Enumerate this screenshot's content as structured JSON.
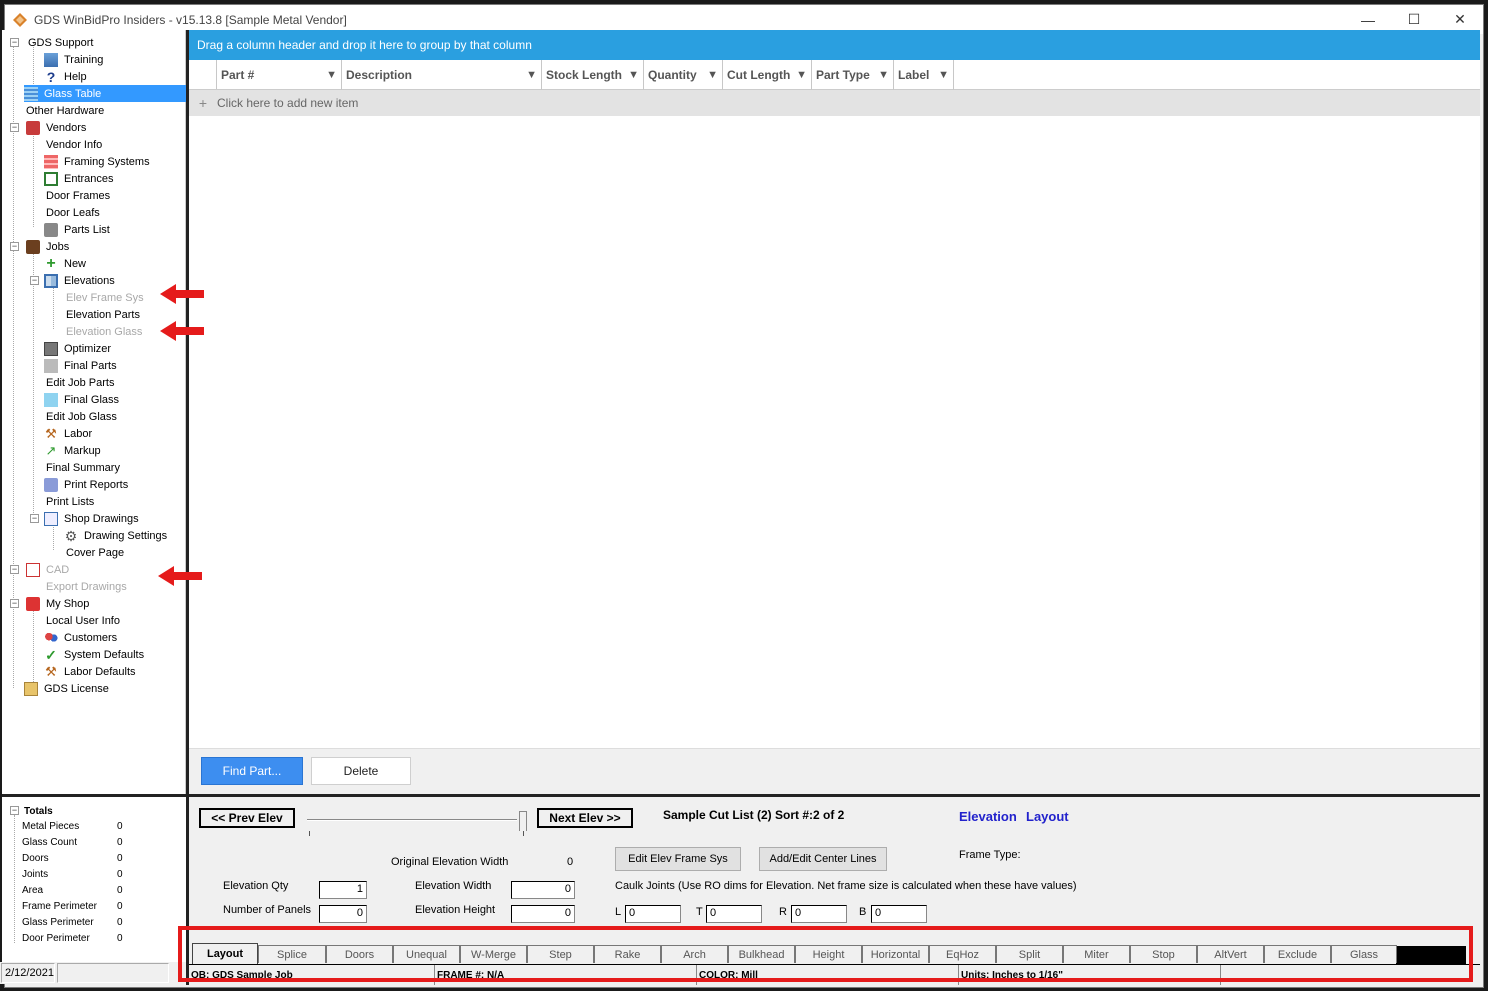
{
  "window": {
    "title": "GDS WinBidPro Insiders - v15.13.8  [Sample Metal Vendor]",
    "minimize": "—",
    "maximize": "☐",
    "close": "✕"
  },
  "tree": {
    "items": [
      {
        "label": "GDS Support"
      },
      {
        "label": "Training"
      },
      {
        "label": "Help"
      },
      {
        "label": "Glass Table"
      },
      {
        "label": "Other Hardware"
      },
      {
        "label": "Vendors"
      },
      {
        "label": "Vendor Info"
      },
      {
        "label": "Framing Systems"
      },
      {
        "label": "Entrances"
      },
      {
        "label": "Door Frames"
      },
      {
        "label": "Door Leafs"
      },
      {
        "label": "Parts List"
      },
      {
        "label": "Jobs"
      },
      {
        "label": "New"
      },
      {
        "label": "Elevations"
      },
      {
        "label": "Elev Frame Sys"
      },
      {
        "label": "Elevation Parts"
      },
      {
        "label": "Elevation Glass"
      },
      {
        "label": "Optimizer"
      },
      {
        "label": "Final Parts"
      },
      {
        "label": "Edit Job Parts"
      },
      {
        "label": "Final Glass"
      },
      {
        "label": "Edit Job Glass"
      },
      {
        "label": "Labor"
      },
      {
        "label": "Markup"
      },
      {
        "label": "Final Summary"
      },
      {
        "label": "Print Reports"
      },
      {
        "label": "Print Lists"
      },
      {
        "label": "Shop Drawings"
      },
      {
        "label": "Drawing Settings"
      },
      {
        "label": "Cover Page"
      },
      {
        "label": "CAD"
      },
      {
        "label": "Export Drawings"
      },
      {
        "label": "My Shop"
      },
      {
        "label": "Local User Info"
      },
      {
        "label": "Customers"
      },
      {
        "label": "System Defaults"
      },
      {
        "label": "Labor Defaults"
      },
      {
        "label": "GDS License"
      }
    ]
  },
  "grid": {
    "group_hint": "Drag a column header and drop it here to group by that column",
    "columns": [
      "Part #",
      "Description",
      "Stock Length",
      "Quantity",
      "Cut Length",
      "Part Type",
      "Label"
    ],
    "new_row": "Click here to add new item",
    "find_part": "Find Part...",
    "delete": "Delete"
  },
  "totals": {
    "header": "Totals",
    "rows": [
      {
        "name": "Metal Pieces",
        "value": "0"
      },
      {
        "name": "Glass Count",
        "value": "0"
      },
      {
        "name": "Doors",
        "value": "0"
      },
      {
        "name": "Joints",
        "value": "0"
      },
      {
        "name": "Area",
        "value": "0"
      },
      {
        "name": "Frame Perimeter",
        "value": "0"
      },
      {
        "name": "Glass Perimeter",
        "value": "0"
      },
      {
        "name": "Door Perimeter",
        "value": "0"
      }
    ]
  },
  "status_left": {
    "date": "2/12/2021",
    "blank": ""
  },
  "elevation": {
    "prev": "<< Prev Elev",
    "next": "Next Elev >>",
    "cutlist": "Sample Cut List (2) Sort #:2  of 2",
    "elev_label": "Elevation",
    "layout_label": "Layout",
    "frame_type": "Frame Type:",
    "orig_width_label": "Original Elevation Width",
    "orig_width_value": "0",
    "edit_frame_sys": "Edit Elev Frame Sys",
    "add_center_lines": "Add/Edit Center Lines",
    "elev_qty_label": "Elevation Qty",
    "elev_qty": "1",
    "elev_width_label": "Elevation Width",
    "elev_width": "0",
    "caulk_note": "Caulk Joints (Use RO dims for Elevation. Net frame size is calculated when these have values)",
    "panels_label": "Number of Panels",
    "panels": "0",
    "elev_height_label": "Elevation Height",
    "elev_height": "0",
    "L": "L",
    "L_val": "0",
    "T": "T",
    "T_val": "0",
    "R": "R",
    "R_val": "0",
    "B": "B",
    "B_val": "0"
  },
  "tabs": [
    "Layout",
    "Splice",
    "Doors",
    "Unequal",
    "W-Merge",
    "Step",
    "Rake",
    "Arch",
    "Bulkhead",
    "Height",
    "Horizontal",
    "EqHoz",
    "Split",
    "Miter",
    "Stop",
    "AltVert",
    "Exclude",
    "Glass"
  ],
  "bottom_status": {
    "job": "OB: GDS Sample Job",
    "frame": "FRAME #: N/A",
    "color": "COLOR: Mill",
    "units": "Units: Inches to 1/16\"",
    "extra": ""
  },
  "colors": {
    "accent": "#2a9fe0",
    "annotation": "#e51b1b",
    "selected": "#3399ff"
  }
}
